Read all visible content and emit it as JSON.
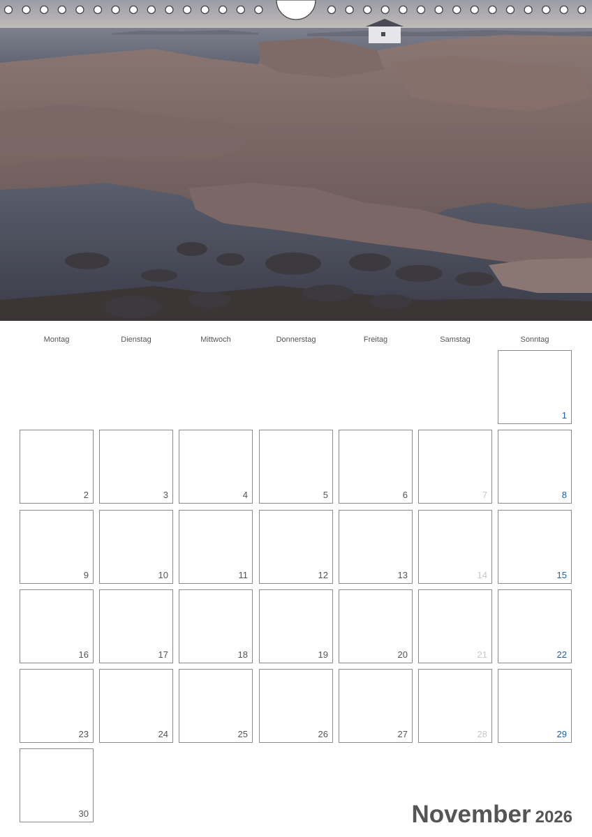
{
  "weekdays": [
    "Montag",
    "Dienstag",
    "Mittwoch",
    "Donnerstag",
    "Freitag",
    "Samstag",
    "Sonntag"
  ],
  "days": [
    "1",
    "2",
    "3",
    "4",
    "5",
    "6",
    "7",
    "8",
    "9",
    "10",
    "11",
    "12",
    "13",
    "14",
    "15",
    "16",
    "17",
    "18",
    "19",
    "20",
    "21",
    "22",
    "23",
    "24",
    "25",
    "26",
    "27",
    "28",
    "29",
    "30"
  ],
  "month": "November",
  "year": "2026",
  "colors": {
    "weekday_number": "#555555",
    "saturday_number": "#c8c8c8",
    "sunday_number": "#1f5fa6",
    "cell_border": "#8a8a8a",
    "title": "#555555"
  }
}
